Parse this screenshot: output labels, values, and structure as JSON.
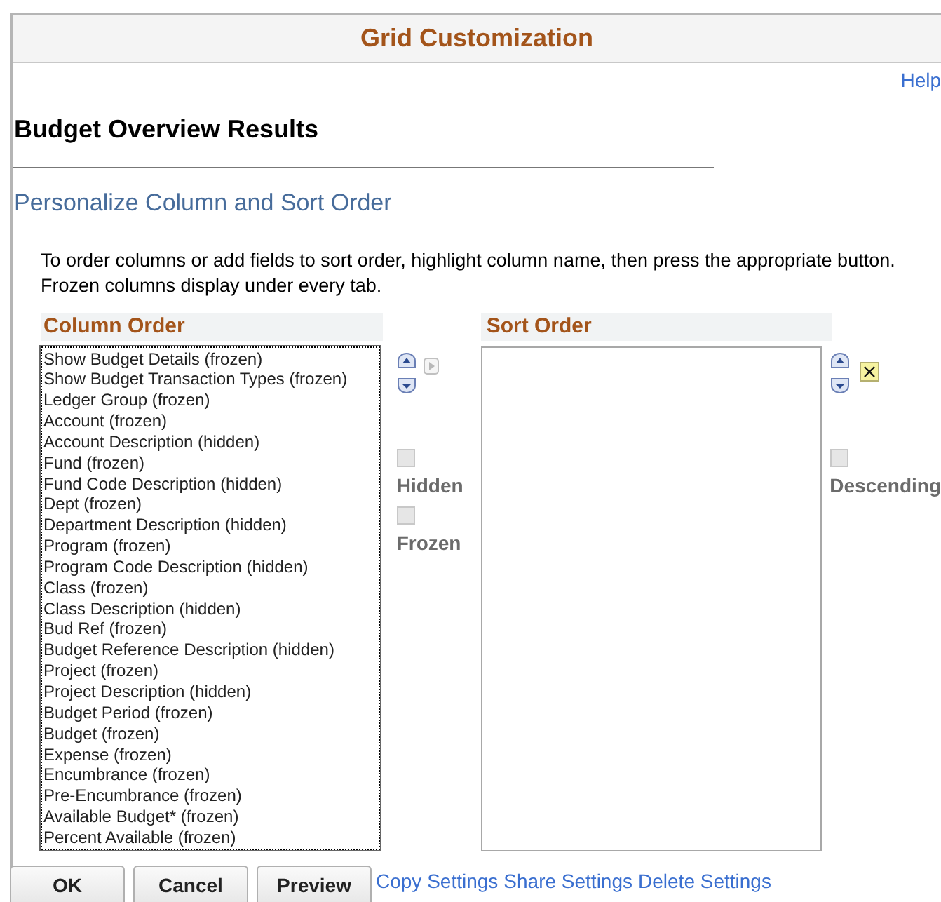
{
  "window": {
    "title": "Grid Customization"
  },
  "help_link": "Help",
  "page_title": "Budget Overview Results",
  "section_title": "Personalize Column and Sort Order",
  "instructions": [
    "To order columns or add fields to sort order, highlight column name, then press the appropriate button.",
    "Frozen columns display under every tab."
  ],
  "column_order": {
    "heading": "Column Order",
    "items": [
      {
        "label": "Show Budget Details (frozen)",
        "selected": false
      },
      {
        "label": "Show Budget Transaction Types (frozen)",
        "selected": false
      },
      {
        "label": "Ledger Group (frozen)",
        "selected": false
      },
      {
        "label": "Account (frozen)",
        "selected": false
      },
      {
        "label": "Account Description (hidden)",
        "selected": false
      },
      {
        "label": "Fund (frozen)",
        "selected": false
      },
      {
        "label": "Fund Code Description (hidden)",
        "selected": false
      },
      {
        "label": "Dept (frozen)",
        "selected": false
      },
      {
        "label": "Department Description (hidden)",
        "selected": false
      },
      {
        "label": "Program (frozen)",
        "selected": false
      },
      {
        "label": "Program Code Description (hidden)",
        "selected": false
      },
      {
        "label": "Class (frozen)",
        "selected": false
      },
      {
        "label": "Class Description (hidden)",
        "selected": false
      },
      {
        "label": "Bud Ref (frozen)",
        "selected": false
      },
      {
        "label": "Budget Reference Description (hidden)",
        "selected": false
      },
      {
        "label": "Project (frozen)",
        "selected": false
      },
      {
        "label": "Project Description (hidden)",
        "selected": false
      },
      {
        "label": "Budget Period (frozen)",
        "selected": false
      },
      {
        "label": "Budget (frozen)",
        "selected": false
      },
      {
        "label": "Expense (frozen)",
        "selected": false
      },
      {
        "label": "Encumbrance (frozen)",
        "selected": false
      },
      {
        "label": "Pre-Encumbrance (frozen)",
        "selected": false
      },
      {
        "label": "Available Budget* (frozen)",
        "selected": false
      },
      {
        "label": "Percent Available (frozen)",
        "selected": false
      }
    ],
    "options": [
      {
        "label": "Hidden",
        "checked": false,
        "disabled": true
      },
      {
        "label": "Frozen",
        "checked": false,
        "disabled": true
      }
    ]
  },
  "sort_order": {
    "heading": "Sort Order",
    "options": [
      {
        "label": "Descending",
        "checked": false,
        "disabled": true
      }
    ]
  },
  "buttons": [
    "OK",
    "Cancel",
    "Preview"
  ],
  "links": [
    "Copy Settings",
    "Share Settings",
    "Delete Settings"
  ]
}
